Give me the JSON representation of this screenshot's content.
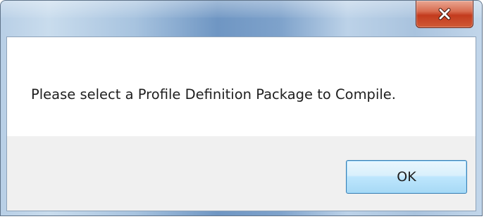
{
  "window": {
    "title": "",
    "close_icon": "close-icon"
  },
  "dialog": {
    "message": "Please select a Profile Definition Package to Compile.",
    "ok_label": "OK"
  },
  "colors": {
    "close_button": "#c94a2c",
    "ok_button_border": "#3c7fb1",
    "button_area_bg": "#f0f0f0"
  }
}
